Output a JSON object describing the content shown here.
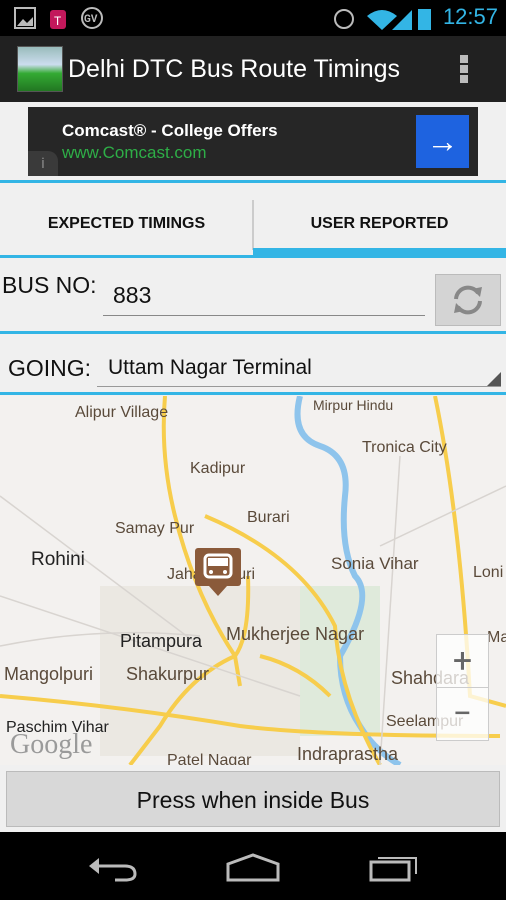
{
  "status_bar": {
    "time": "12:57",
    "icons": [
      "picture-icon",
      "tmobile-icon",
      "google-voice-icon",
      "alarm-icon",
      "wifi-icon",
      "signal-icon",
      "battery-icon"
    ]
  },
  "action_bar": {
    "title": "Delhi DTC Bus Route Timings",
    "icon": "bus-app-icon",
    "menu": "overflow-menu-icon"
  },
  "ad": {
    "title": "Comcast® - College Offers",
    "url": "www.Comcast.com",
    "arrow": "→",
    "info": "i"
  },
  "tabs": [
    {
      "label": "EXPECTED TIMINGS",
      "selected": false
    },
    {
      "label": "USER REPORTED",
      "selected": true
    }
  ],
  "form": {
    "bus_label": "BUS NO:",
    "bus_value": "883",
    "going_label": "GOING:",
    "going_value": "Uttam Nagar Terminal"
  },
  "map": {
    "labels": [
      "Alipur Village",
      "Mirpur Hindu",
      "Tronica City",
      "Kadipur",
      "Burari",
      "Samay Pur",
      "Rohini",
      "Jahangirpuri",
      "Sonia Vihar",
      "Loni",
      "Pitampura",
      "Mukherjee Nagar",
      "Mangolpuri",
      "Shakurpur",
      "Shahdara",
      "Paschim Vihar",
      "Seelampur",
      "Patel Nagar",
      "Indraprastha",
      "Ma"
    ],
    "logo": "Google",
    "zoom_in": "+",
    "zoom_out": "−"
  },
  "main_button": "Press when inside Bus",
  "colors": {
    "accent": "#33b5e5",
    "ad_button": "#1e63e0",
    "ad_url": "#2eae47",
    "marker": "#8a5a3a"
  }
}
